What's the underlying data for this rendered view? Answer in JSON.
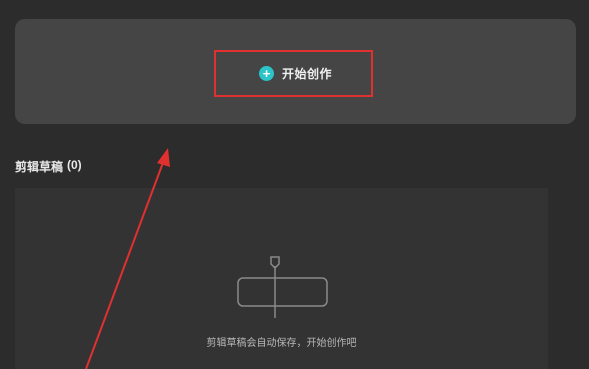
{
  "hero": {
    "create_label": "开始创作",
    "plus_icon": "plus-circle-icon",
    "accent_color": "#2bc4c9"
  },
  "drafts": {
    "title": "剪辑草稿",
    "count": "(0)",
    "empty_icon": "timeline-empty-icon",
    "empty_message": "剪辑草稿会自动保存，开始创作吧"
  },
  "annotation": {
    "color": "#e03030"
  }
}
